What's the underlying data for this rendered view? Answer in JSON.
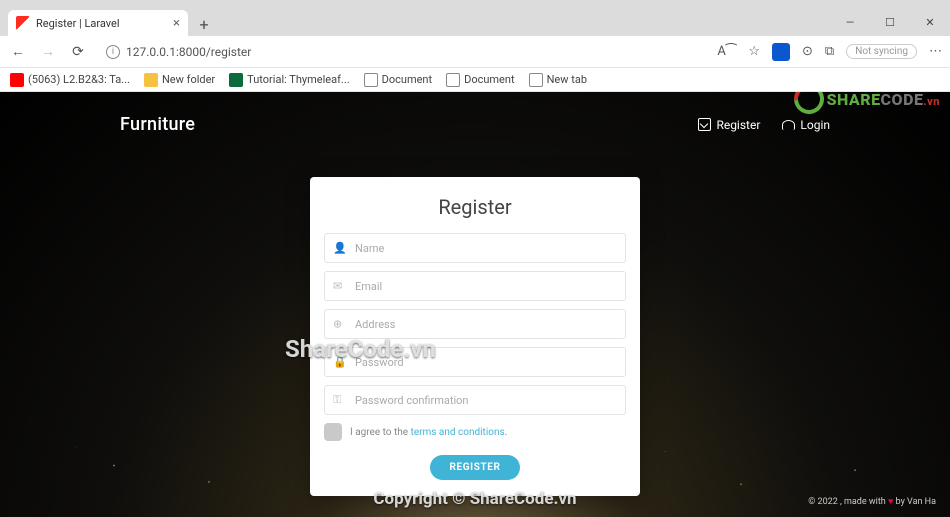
{
  "browser": {
    "tab_title": "Register | Laravel",
    "url": "127.0.0.1:8000/register",
    "reader_icon": "A⁀",
    "sync_label": "Not syncing"
  },
  "bookmarks": [
    {
      "label": "(5063) L2.B2&3: Ta...",
      "cls": "yt"
    },
    {
      "label": "New folder",
      "cls": "fold"
    },
    {
      "label": "Tutorial: Thymeleaf...",
      "cls": "thy"
    },
    {
      "label": "Document",
      "cls": "doc"
    },
    {
      "label": "Document",
      "cls": "doc"
    },
    {
      "label": "New tab",
      "cls": "doc"
    }
  ],
  "nav": {
    "brand": "Furniture",
    "register": "Register",
    "login": "Login"
  },
  "form": {
    "heading": "Register",
    "name_ph": "Name",
    "email_ph": "Email",
    "address_ph": "Address",
    "password_ph": "Password",
    "passconf_ph": "Password confirmation",
    "agree_pre": "I agree to the ",
    "agree_link": "terms and conditions",
    "agree_post": ".",
    "submit": "REGISTER"
  },
  "watermark": {
    "center": "ShareCode.vn",
    "logo_share": "SHARE",
    "logo_code": "CODE",
    "logo_vn": ".vn",
    "footer": "Copyright © ShareCode.vn"
  },
  "footer": {
    "year": "© 2022",
    "made": " , made with ",
    "by": " by Van Ha"
  }
}
